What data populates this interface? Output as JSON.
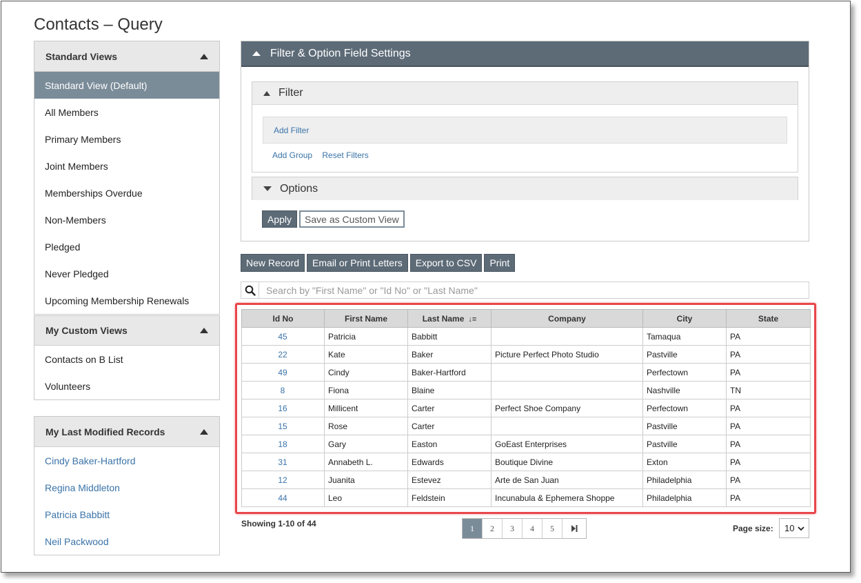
{
  "page": {
    "title": "Contacts – Query"
  },
  "sidebar": {
    "standard_views": {
      "title": "Standard Views",
      "items": [
        {
          "label": "Standard View (Default)"
        },
        {
          "label": "All Members"
        },
        {
          "label": "Primary Members"
        },
        {
          "label": "Joint Members"
        },
        {
          "label": "Memberships Overdue"
        },
        {
          "label": "Non-Members"
        },
        {
          "label": "Pledged"
        },
        {
          "label": "Never Pledged"
        },
        {
          "label": "Upcoming Membership Renewals"
        }
      ]
    },
    "custom_views": {
      "title": "My Custom Views",
      "items": [
        {
          "label": "Contacts on B List"
        },
        {
          "label": "Volunteers"
        }
      ]
    },
    "last_modified": {
      "title": "My Last Modified Records",
      "items": [
        {
          "label": "Cindy Baker-Hartford"
        },
        {
          "label": "Regina Middleton"
        },
        {
          "label": "Patricia Babbitt"
        },
        {
          "label": "Neil Packwood"
        }
      ]
    }
  },
  "settings": {
    "title": "Filter & Option Field Settings",
    "filter": {
      "title": "Filter",
      "add_filter": "Add Filter",
      "add_group": "Add Group",
      "reset_filters": "Reset Filters"
    },
    "options": {
      "title": "Options"
    },
    "apply_label": "Apply",
    "save_custom_label": "Save as Custom View"
  },
  "toolbar": {
    "new_record": "New Record",
    "email_print": "Email or Print Letters",
    "export_csv": "Export to CSV",
    "print": "Print"
  },
  "search": {
    "placeholder": "Search by \"First Name\" or \"Id No\" or \"Last Name\""
  },
  "grid": {
    "columns": [
      "Id No",
      "First Name",
      "Last Name",
      "Company",
      "City",
      "State"
    ],
    "rows": [
      [
        "45",
        "Patricia",
        "Babbitt",
        "",
        "Tamaqua",
        "PA"
      ],
      [
        "22",
        "Kate",
        "Baker",
        "Picture Perfect Photo Studio",
        "Pastville",
        "PA"
      ],
      [
        "49",
        "Cindy",
        "Baker-Hartford",
        "",
        "Perfectown",
        "PA"
      ],
      [
        "8",
        "Fiona",
        "Blaine",
        "",
        "Nashville",
        "TN"
      ],
      [
        "16",
        "Millicent",
        "Carter",
        "Perfect Shoe Company",
        "Perfectown",
        "PA"
      ],
      [
        "15",
        "Rose",
        "Carter",
        "",
        "Pastville",
        "PA"
      ],
      [
        "18",
        "Gary",
        "Easton",
        "GoEast Enterprises",
        "Pastville",
        "PA"
      ],
      [
        "31",
        "Annabeth L.",
        "Edwards",
        "Boutique Divine",
        "Exton",
        "PA"
      ],
      [
        "12",
        "Juanita",
        "Estevez",
        "Arte de San Juan",
        "Philadelphia",
        "PA"
      ],
      [
        "44",
        "Leo",
        "Feldstein",
        "Incunabula & Ephemera Shoppe",
        "Philadelphia",
        "PA"
      ]
    ]
  },
  "footer": {
    "showing": "Showing 1-10 of 44",
    "pages": [
      "1",
      "2",
      "3",
      "4",
      "5"
    ],
    "current_page": "1",
    "page_size_label": "Page size:",
    "page_size": "10"
  },
  "colors": {
    "accent": "#5d6b77",
    "active_item": "#7b8c99",
    "link": "#3a73a8",
    "highlight": "#e8464a"
  }
}
